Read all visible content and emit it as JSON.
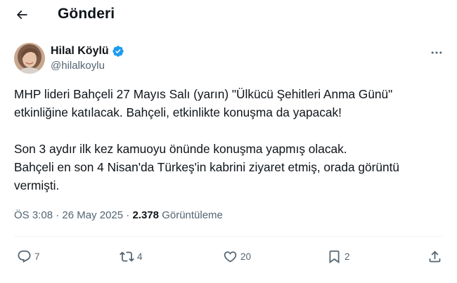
{
  "header": {
    "title": "Gönderi"
  },
  "author": {
    "name": "Hilal Köylü",
    "handle": "@hilalkoylu",
    "verified": true
  },
  "tweet": {
    "lines": [
      "MHP lideri Bahçeli 27 Mayıs Salı (yarın) \"Ülkücü Şehitleri Anma Günü\"",
      "etkinliğine katılacak.  Bahçeli, etkinlikte konuşma da yapacak!",
      "Son 3 aydır ilk kez kamuoyu önünde konuşma yapmış olacak.",
      "Bahçeli en son 4 Nisan'da Türkeş'in kabrini ziyaret etmiş, orada görüntü",
      "vermişti."
    ]
  },
  "meta": {
    "time": "ÖS 3:08",
    "separator": "·",
    "date": "26 May 2025",
    "views_count": "2.378",
    "views_label": "Görüntüleme"
  },
  "actions": {
    "replies": "7",
    "retweets": "4",
    "likes": "20",
    "bookmarks": "2"
  },
  "colors": {
    "text": "#0f1419",
    "secondary": "#536471",
    "verified": "#1d9bf0",
    "divider": "#eff3f4"
  }
}
